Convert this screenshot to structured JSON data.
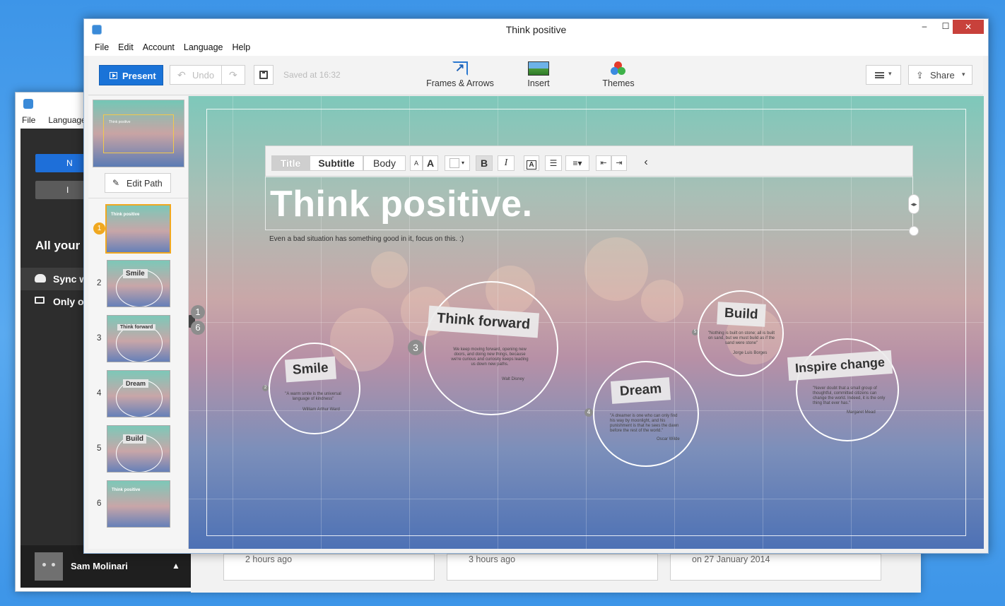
{
  "background_window": {
    "menu": [
      "File",
      "Language"
    ],
    "buttons": [
      "N",
      "I"
    ],
    "heading": "All your p",
    "rows": [
      "Sync w",
      "Only o"
    ],
    "user_name": "Sam Molinari",
    "cards": [
      "2 hours ago",
      "3 hours ago",
      "on 27 January 2014"
    ]
  },
  "window": {
    "title": "Think positive",
    "controls": {
      "minimize": "–",
      "maximize": "☐",
      "close": "✕"
    },
    "menu": [
      "File",
      "Edit",
      "Account",
      "Language",
      "Help"
    ]
  },
  "toolbar": {
    "present_label": "Present",
    "undo_label": "Undo",
    "undo_icon": "↶",
    "redo_icon": "↷",
    "saved_text": "Saved at 16:32",
    "frames_label": "Frames & Arrows",
    "insert_label": "Insert",
    "themes_label": "Themes",
    "share_label": "Share",
    "share_icon": "⇪",
    "caret": "▾"
  },
  "sidebar": {
    "overview_title": "Think positive",
    "edit_path_label": "Edit Path",
    "edit_path_icon": "✎",
    "slides": [
      {
        "num": "1",
        "label": "Think positive"
      },
      {
        "num": "2",
        "label": "Smile"
      },
      {
        "num": "3",
        "label": "Think forward"
      },
      {
        "num": "4",
        "label": "Dream"
      },
      {
        "num": "5",
        "label": "Build"
      },
      {
        "num": "6",
        "label": "Think positive"
      }
    ]
  },
  "format_bar": {
    "title": "Title",
    "subtitle": "Subtitle",
    "body": "Body",
    "font_small": "A",
    "font_large": "A",
    "bold": "B",
    "italic": "I",
    "highlight": "A",
    "list_icon": "☰",
    "align_icon": "≡▾",
    "outdent_icon": "⇤",
    "indent_icon": "⇥",
    "collapse_icon": "‹"
  },
  "canvas": {
    "title": "Think positive.",
    "subtitle": "Even a bad situation has something good in it, focus on this. :)",
    "path_numbers": [
      "1",
      "6"
    ],
    "resize_icon": "◂▸",
    "bubbles": [
      {
        "caption": "Smile",
        "num": "2",
        "quote": "\"A warm smile is the universal language of kindness\"",
        "author": "William Arthur Ward"
      },
      {
        "caption": "Think forward",
        "num": "3",
        "quote": "We keep moving forward, opening new doors, and doing new things, because we're curious and curiosity keeps leading us down new paths.",
        "author": "Walt Disney"
      },
      {
        "caption": "Dream",
        "num": "4",
        "quote": "\"A dreamer is one who can only find his way by moonlight, and his punishment is that he sees the dawn before the rest of the world.\"",
        "author": "Oscar Wilde"
      },
      {
        "caption": "Build",
        "num": "5",
        "quote": "\"Nothing is built on stone; all is built on sand, but we must build as if the sand were stone\"",
        "author": "Jorge Luis Borges"
      },
      {
        "caption": "Inspire change",
        "num": "",
        "quote": "\"Never doubt that a small group of thoughtful, committed citizens can change the world. Indeed, it is the only thing that ever has.\"",
        "author": "Margaret Mead"
      }
    ]
  },
  "colors": {
    "accent": "#1a73d8",
    "selection": "#f0a820",
    "close": "#c8413b"
  }
}
